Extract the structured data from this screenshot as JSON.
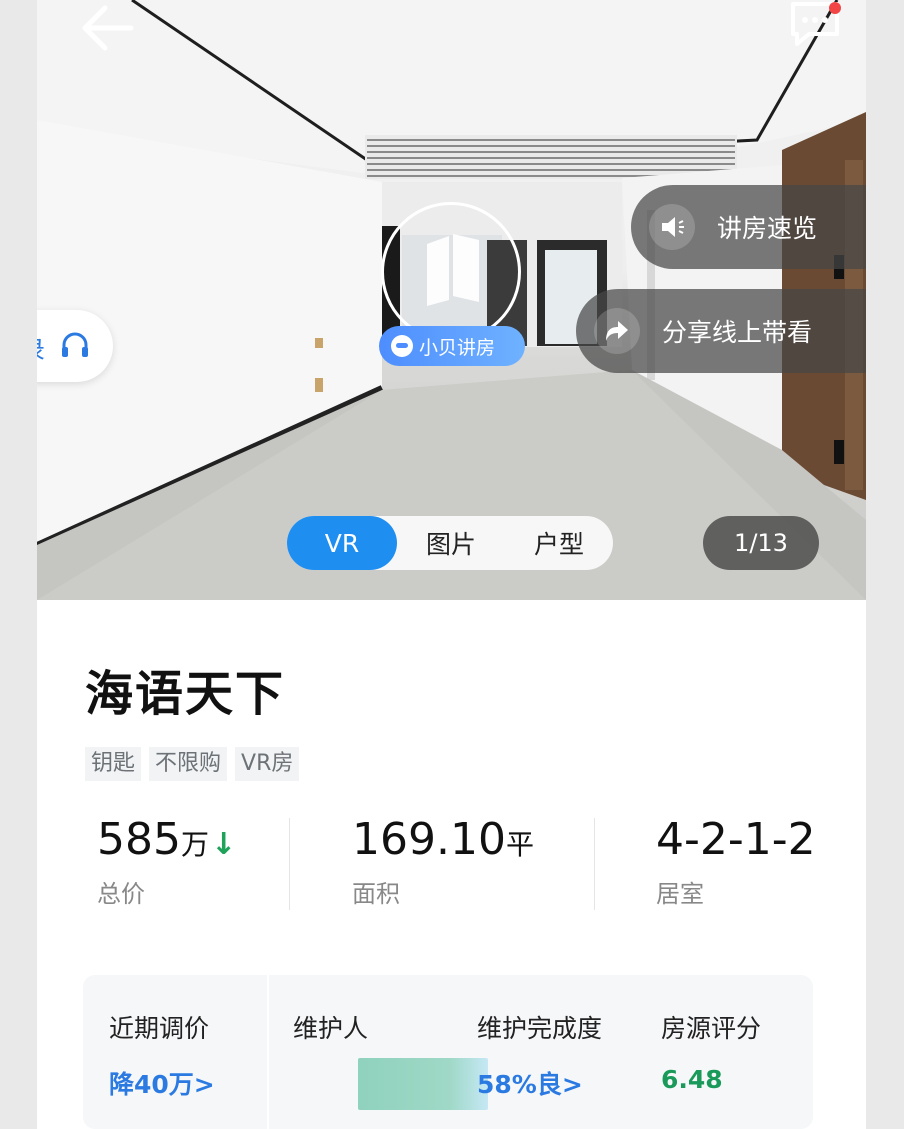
{
  "hero": {
    "agent_label": "小贝讲房",
    "quick_tour_label": "讲房速览",
    "share_label": "分享线上带看",
    "left_tab_partial": "录",
    "tabs": [
      {
        "label": "VR",
        "active": true
      },
      {
        "label": "图片",
        "active": false
      },
      {
        "label": "户型",
        "active": false
      }
    ],
    "counter": "1/13"
  },
  "listing": {
    "title": "海语天下",
    "tags": [
      "钥匙",
      "不限购",
      "VR房"
    ],
    "price": {
      "value": "585",
      "unit": "万",
      "label": "总价",
      "trend": "down"
    },
    "area": {
      "value": "169.10",
      "unit": "平",
      "label": "面积"
    },
    "rooms": {
      "value": "4-2-1-2",
      "label": "居室"
    }
  },
  "summary": {
    "price_adjust": {
      "header": "近期调价",
      "value": "降40万>"
    },
    "maintainer": {
      "header": "维护人"
    },
    "completion": {
      "header": "维护完成度",
      "value": "58%良>"
    },
    "score": {
      "header": "房源评分",
      "value": "6.48"
    }
  },
  "colors": {
    "accent_blue": "#1f8ef1",
    "link_blue": "#2a7ae2",
    "score_green": "#1a9a5a",
    "notify_red": "#f24646"
  },
  "icons": [
    "back-arrow-icon",
    "chat-icon",
    "vr-logo-icon",
    "robot-icon",
    "speaker-icon",
    "share-arrow-icon",
    "headset-icon",
    "down-arrow-icon"
  ]
}
